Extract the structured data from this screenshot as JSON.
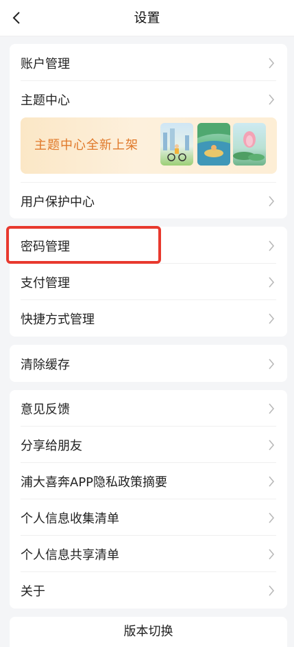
{
  "header": {
    "title": "设置"
  },
  "group1": {
    "account": "账户管理",
    "theme": "主题中心",
    "banner_text": "主题中心全新上架",
    "protection": "用户保护中心"
  },
  "group2": {
    "password": "密码管理",
    "payment": "支付管理",
    "shortcut": "快捷方式管理"
  },
  "group3": {
    "clear_cache": "清除缓存"
  },
  "group4": {
    "feedback": "意见反馈",
    "share": "分享给朋友",
    "privacy_summary": "浦大喜奔APP隐私政策摘要",
    "info_collect": "个人信息收集清单",
    "info_share": "个人信息共享清单",
    "about": "关于"
  },
  "version": {
    "label": "版本切换"
  },
  "colors": {
    "accent_orange": "#e0792a",
    "highlight_red": "#e8392e"
  }
}
